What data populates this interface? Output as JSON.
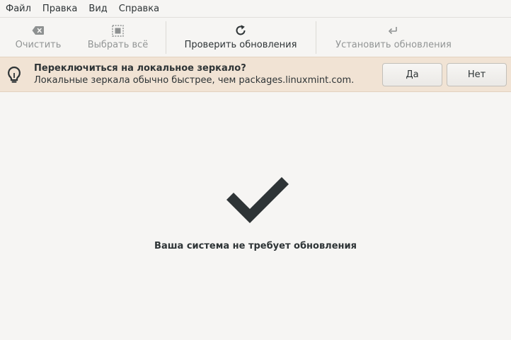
{
  "menu": {
    "items": [
      {
        "label": "Файл"
      },
      {
        "label": "Правка"
      },
      {
        "label": "Вид"
      },
      {
        "label": "Справка"
      }
    ]
  },
  "toolbar": {
    "clear_label": "Очистить",
    "select_all_label": "Выбрать всё",
    "refresh_label": "Проверить обновления",
    "install_label": "Установить обновления"
  },
  "infobar": {
    "title": "Переключиться на локальное зеркало?",
    "message": "Локальные зеркала обычно быстрее, чем packages.linuxmint.com.",
    "yes_label": "Да",
    "no_label": "Нет",
    "icon": "lightbulb-icon",
    "background_color": "#f1e3d4"
  },
  "main": {
    "status_text": "Ваша система не требует обновления",
    "icon": "checkmark-icon"
  }
}
